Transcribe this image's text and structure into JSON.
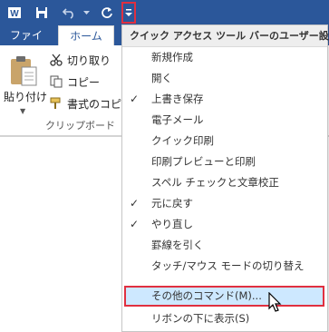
{
  "tabs": {
    "file": "ファイル",
    "home": "ホーム"
  },
  "ribbon": {
    "paste_label": "貼り付け",
    "cut_label": "切り取り",
    "copy_label": "コピー",
    "format_painter_label": "書式のコピー",
    "clipboard_group_label": "クリップボード"
  },
  "qat_menu": {
    "title": "クイック アクセス ツール バーのユーザー設定",
    "items": [
      {
        "label": "新規作成",
        "checked": false
      },
      {
        "label": "開く",
        "checked": false
      },
      {
        "label": "上書き保存",
        "checked": true
      },
      {
        "label": "電子メール",
        "checked": false
      },
      {
        "label": "クイック印刷",
        "checked": false
      },
      {
        "label": "印刷プレビューと印刷",
        "checked": false
      },
      {
        "label": "スペル チェックと文章校正",
        "checked": false
      },
      {
        "label": "元に戻す",
        "checked": true
      },
      {
        "label": "やり直し",
        "checked": true
      },
      {
        "label": "罫線を引く",
        "checked": false
      },
      {
        "label": "タッチ/マウス モードの切り替え",
        "checked": false
      },
      {
        "label": "その他のコマンド(M)...",
        "checked": false
      },
      {
        "label": "リボンの下に表示(S)",
        "checked": false
      }
    ],
    "check_glyph": "✓"
  },
  "colors": {
    "brand_blue": "#2b579a",
    "highlight_bg": "#cde8ff",
    "highlight_border": "#e03040"
  },
  "icons": {
    "word": "word-icon",
    "save": "save-icon",
    "undo": "undo-icon",
    "redo": "redo-icon",
    "customize": "customize-qat-icon"
  }
}
